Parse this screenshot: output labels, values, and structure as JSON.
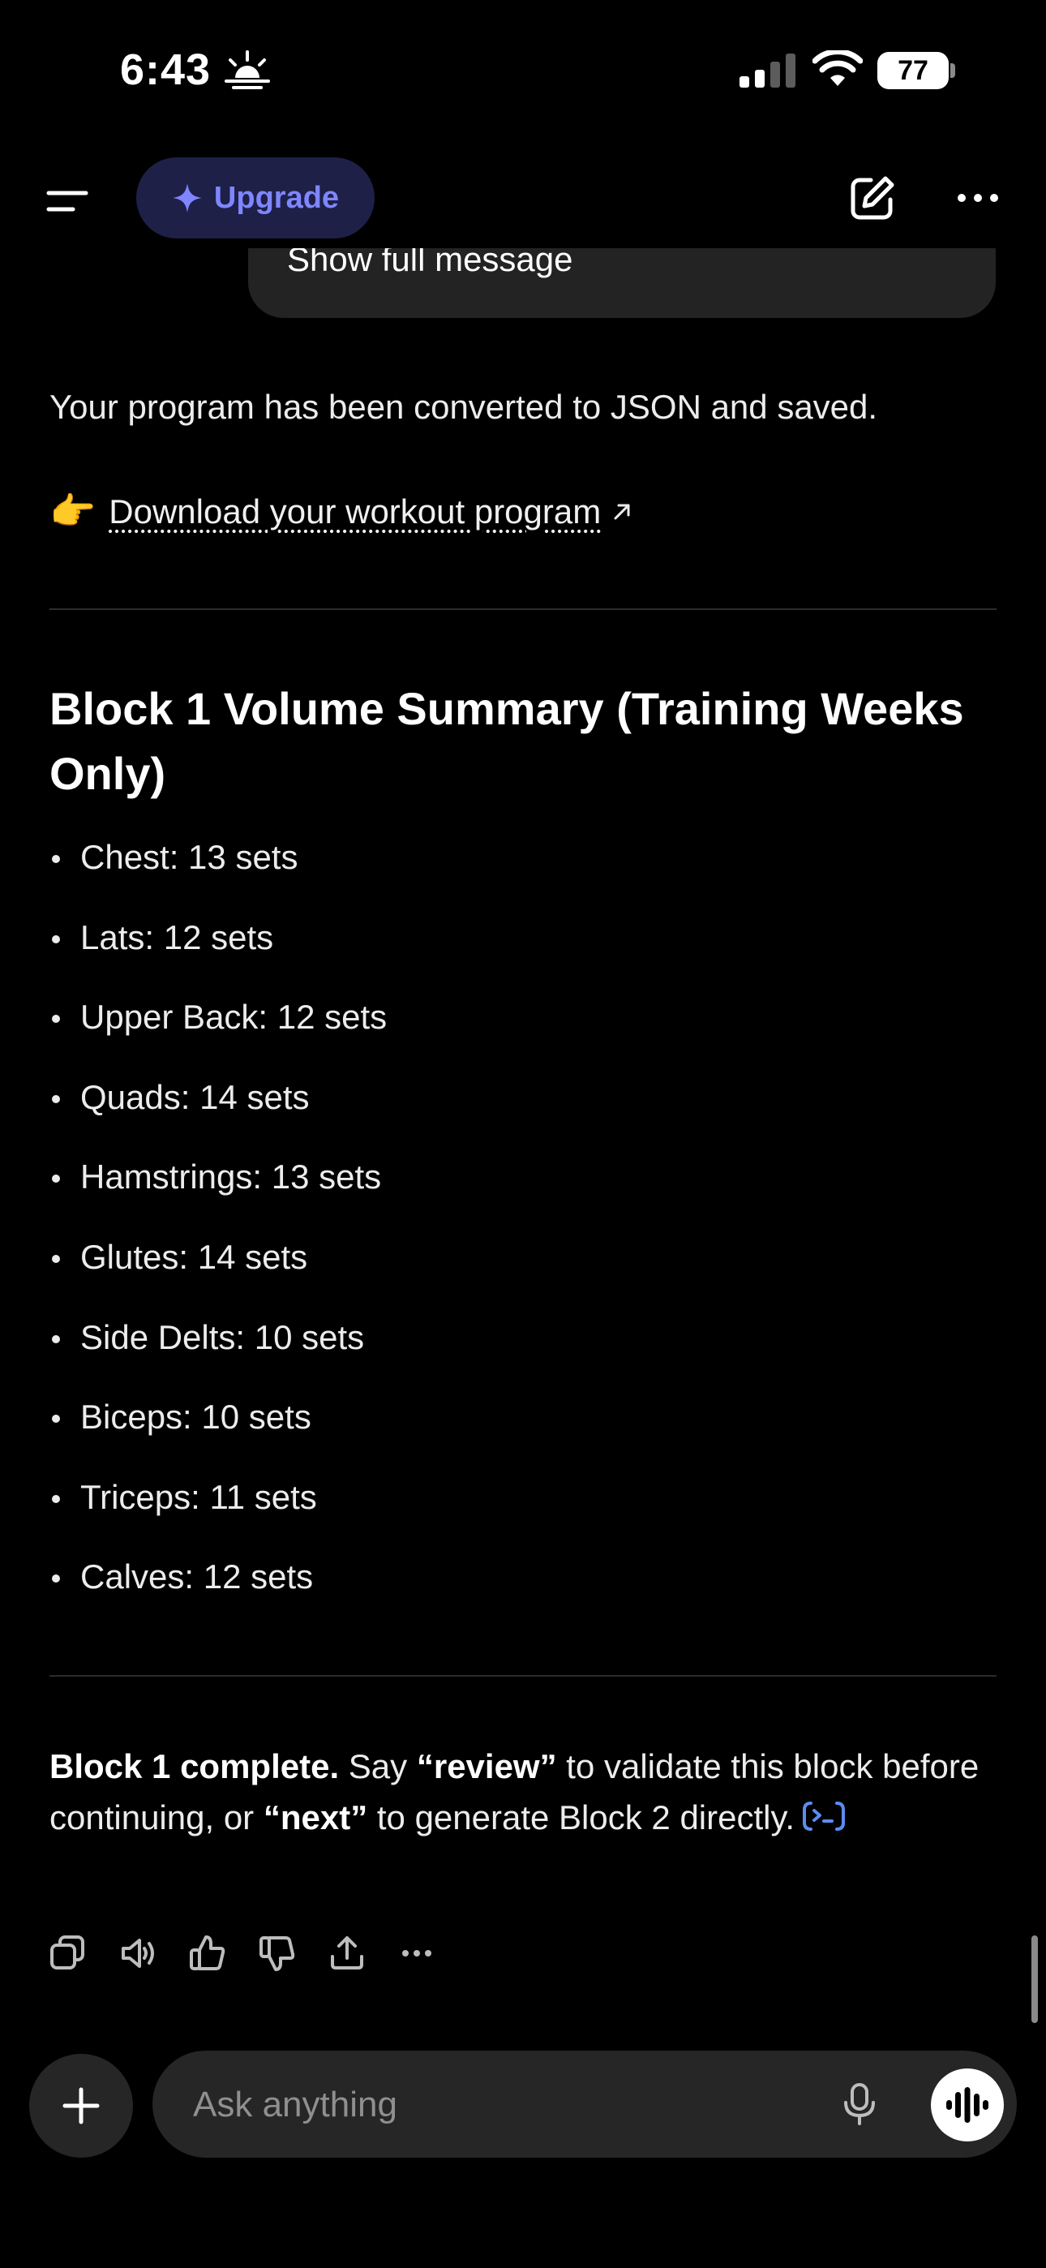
{
  "status_bar": {
    "time": "6:43",
    "battery": "77"
  },
  "header": {
    "upgrade_label": "Upgrade"
  },
  "user_message": {
    "toggle_label": "Show full message"
  },
  "assistant": {
    "saved_text": "Your program has been converted to JSON and saved.",
    "download_emoji": "👉",
    "download_label": "Download your workout program",
    "summary_title": "Block 1 Volume Summary (Training Weeks Only)",
    "volume_items": [
      "Chest: 13 sets",
      "Lats: 12 sets",
      "Upper Back: 12 sets",
      "Quads: 14 sets",
      "Hamstrings: 13 sets",
      "Glutes: 14 sets",
      "Side Delts: 10 sets",
      "Biceps: 10 sets",
      "Triceps: 11 sets",
      "Calves: 12 sets"
    ],
    "closing": {
      "bold_lead": "Block 1 complete.",
      "text_1": " Say ",
      "review": "“review”",
      "text_2": " to validate this block before continuing, or ",
      "next": "“next”",
      "text_3": " to generate Block 2 directly."
    }
  },
  "composer": {
    "placeholder": "Ask anything"
  },
  "colors": {
    "background": "#000000",
    "upgrade_bg": "#1e2048",
    "upgrade_accent": "#7f86ff",
    "surface": "#262626",
    "tool_chip": "#5a8dee"
  }
}
